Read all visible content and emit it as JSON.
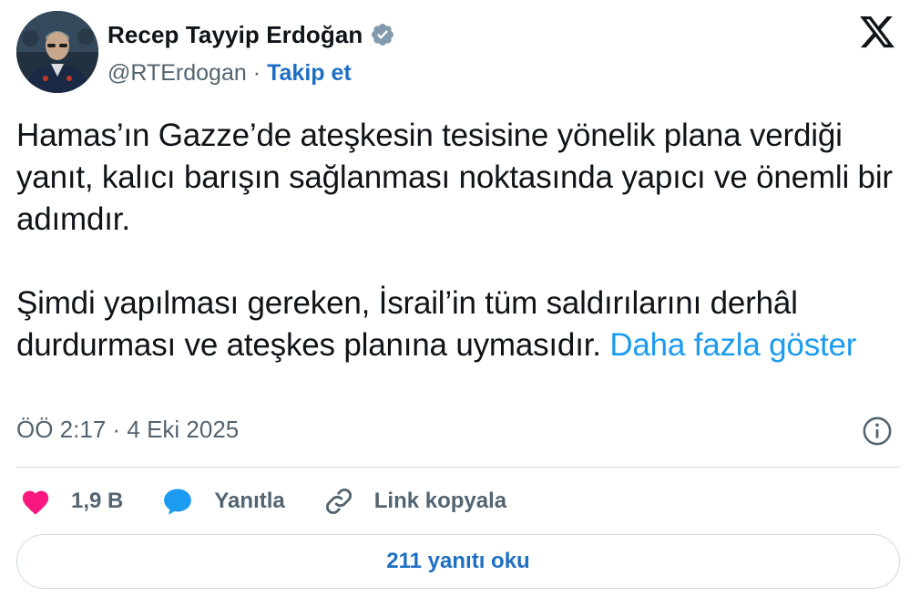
{
  "author": {
    "name": "Recep Tayyip Erdoğan",
    "handle": "@RTErdogan",
    "separator": "·",
    "follow_label": "Takip et",
    "verified": true,
    "avatar_icon": "profile-photo",
    "verified_icon": "verified-badge-icon"
  },
  "platform": {
    "logo_icon": "x-logo-icon"
  },
  "tweet": {
    "paragraph1": "Hamas’ın Gazze’de ateşkesin tesisine yönelik plana verdiği yanıt, kalıcı barışın sağlanması noktasında yapıcı ve önemli bir adımdır.",
    "paragraph2": "Şimdi yapılması gereken, İsrail’in tüm saldırılarını derhâl durdurması ve ateşkes planına uymasıdır.",
    "show_more": "Daha fazla göster",
    "timestamp": "ÖÖ 2:17 · 4 Eki 2025"
  },
  "actions": {
    "likes": "1,9 B",
    "reply_label": "Yanıtla",
    "copy_link_label": "Link kopyala"
  },
  "replies_button": "211 yanıtı oku",
  "colors": {
    "link": "#1d9bf0",
    "follow": "#1d6fc4",
    "heart": "#f91880",
    "reply_bubble": "#1d9bf0",
    "verified_badge": "#829aab",
    "muted": "#536471"
  }
}
